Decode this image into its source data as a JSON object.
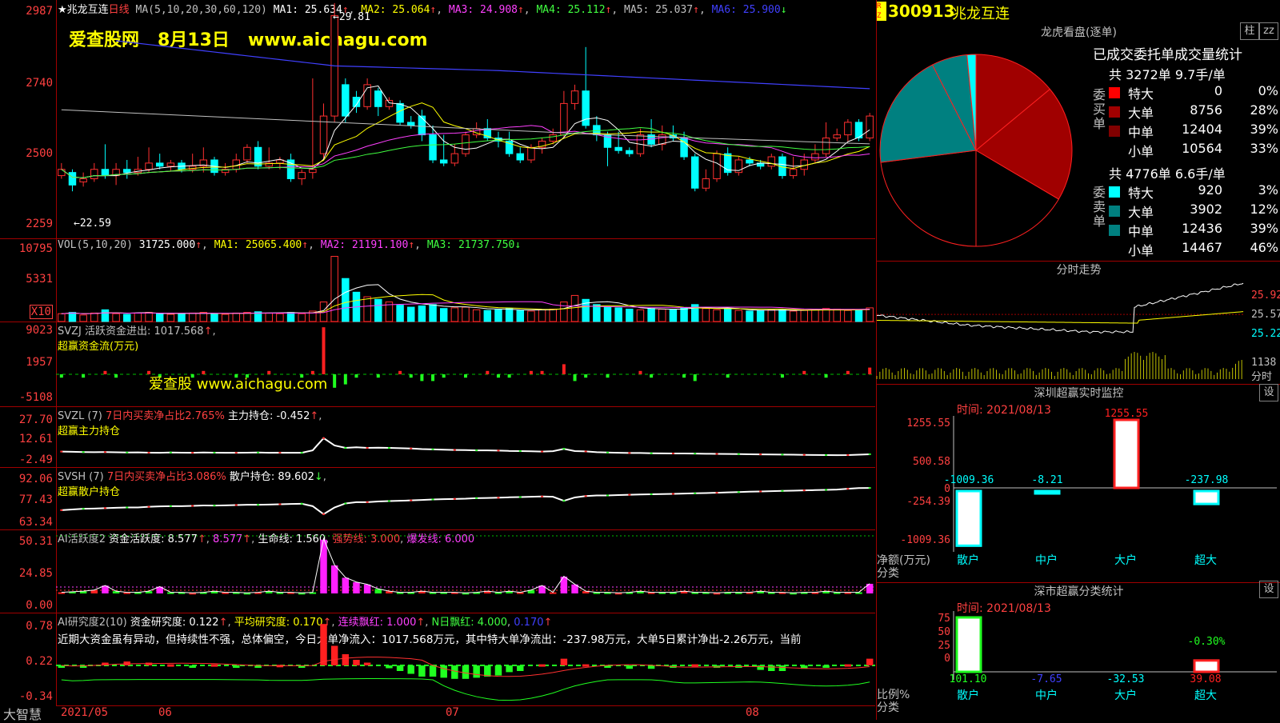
{
  "header": {
    "name": "兆龙互连",
    "period": "日线",
    "ma_params": "MA(5,10,20,30,60,120)",
    "ma1": "MA1: 25.634",
    "ma2": "MA2: 25.064",
    "ma3": "MA3: 24.908",
    "ma4": "MA4: 25.112",
    "ma5": "MA5: 25.037",
    "ma6": "MA6: 25.900",
    "watermark": "爱查股网   8月13日   www.aichagu.com",
    "high_label": "29.81",
    "low_label": "22.59"
  },
  "axes": {
    "main": [
      "2987",
      "2740",
      "2500",
      "2259"
    ],
    "vol": [
      "10795",
      "5331",
      "X10"
    ],
    "svzj": [
      "9023",
      "1957",
      "-5108"
    ],
    "svzl": [
      "27.70",
      "12.61",
      "-2.49"
    ],
    "svsh": [
      "92.06",
      "77.43",
      "63.34"
    ],
    "ai": [
      "50.31",
      "24.85",
      "0.00"
    ],
    "air": [
      "0.78",
      "0.22",
      "-0.34"
    ],
    "dates": [
      "2021/05",
      "06",
      "07",
      "08"
    ],
    "brand": "大智慧"
  },
  "vol_hdr": {
    "a": "VOL(5,10,20)",
    "b": "31725.000",
    "c": "MA1: 25065.400",
    "d": "MA2: 21191.100",
    "e": "MA3: 21737.750"
  },
  "svzj_hdr": {
    "a": "SVZJ  活跃资金进出: 1017.568",
    "b": "超赢资金流(万元)",
    "wm": "爱查股 www.aichagu.com"
  },
  "svzl_hdr": {
    "a": "SVZL (7)",
    "b": "7日内买卖净占比2.765%",
    "c": "主力持仓: -0.452",
    "d": "超赢主力持仓"
  },
  "svsh_hdr": {
    "a": "SVSH (7)",
    "b": "7日内买卖净占比3.086%",
    "c": "散户持仓: 89.602",
    "d": "超赢散户持仓"
  },
  "ai_hdr": {
    "a": "AI活跃度2",
    "b": "资金活跃度: 8.577",
    "c": "8.577",
    "d": "生命线: 1.560",
    "e": "强势线: 3.000",
    "f": "爆发线: 6.000"
  },
  "air_hdr": {
    "a": "AI研究度2(10)",
    "b": "资金研究度: 0.122",
    "c": "平均研究度: 0.170",
    "d": "连续飘红: 1.000",
    "e": "N日飘红: 4.000",
    "f": "0.170",
    "text": "近期大资金虽有异动，但持续性不强，总体偏空，今日大单净流入：1017.568万元，其中特大单净流出：-237.98万元，大单5日累计净出-2.26万元，当前"
  },
  "right": {
    "code": "300913",
    "name": "兆龙互连",
    "rz": "R Z",
    "lhkp": "龙虎看盘(逐单)",
    "btn_zhu": "柱",
    "btn_ji": "zz",
    "stats_title": "已成交委托单成交量统计",
    "buy_total": "共 3272单 9.7手/单",
    "buy_label": "委买单",
    "sell_total": "共 4776单 6.6手/单",
    "sell_label": "委卖单",
    "buy": [
      {
        "n": "特大",
        "v": "0",
        "p": "0%",
        "c": "#ff0000"
      },
      {
        "n": "大单",
        "v": "8756",
        "p": "28%",
        "c": "#a00000"
      },
      {
        "n": "中单",
        "v": "12404",
        "p": "39%",
        "c": "#800000"
      },
      {
        "n": "小单",
        "v": "10564",
        "p": "33%",
        "c": "#000000"
      }
    ],
    "sell": [
      {
        "n": "特大",
        "v": "920",
        "p": "3%",
        "c": "#00ffff"
      },
      {
        "n": "大单",
        "v": "3902",
        "p": "12%",
        "c": "#008080"
      },
      {
        "n": "中单",
        "v": "12436",
        "p": "39%",
        "c": "#008080"
      },
      {
        "n": "小单",
        "v": "14467",
        "p": "46%",
        "c": "#000000"
      }
    ],
    "fs_title": "分时走势",
    "fs_y": [
      "25.92",
      "25.57",
      "25.22"
    ],
    "fs_vol": "1138",
    "fs_unit": "分时",
    "mon_title": "深圳超赢实时监控",
    "mon_set": "设",
    "mon_time": "时间: 2021/08/13",
    "mon_y": [
      "1255.55",
      "500.58",
      "0",
      "-254.39",
      "-1009.36"
    ],
    "mon_unit": "净额(万元)",
    "mon_cls": "分类",
    "mon_vals": [
      "-1009.36",
      "-8.21",
      "1255.55",
      "-237.98"
    ],
    "cats": [
      "散户",
      "中户",
      "大户",
      "超大"
    ],
    "cls_title": "深市超赢分类统计",
    "cls_set": "设",
    "cls_time": "时间: 2021/08/13",
    "cls_y": [
      "75",
      "50",
      "25",
      "0"
    ],
    "cls_unit": "比例%",
    "cls_cls": "分类",
    "cls_vals": [
      "101.10",
      "-7.65",
      "-32.53",
      "39.08"
    ],
    "cls_top": "-0.30%"
  },
  "chart_data": {
    "type": "candlestick",
    "main_ylim": [
      2230,
      2990
    ],
    "candles": [
      [
        2430,
        2450,
        2420,
        2470
      ],
      [
        2440,
        2400,
        2380,
        2450
      ],
      [
        2410,
        2420,
        2395,
        2440
      ],
      [
        2420,
        2450,
        2410,
        2470
      ],
      [
        2450,
        2430,
        2420,
        2530
      ],
      [
        2430,
        2450,
        2400,
        2470
      ],
      [
        2450,
        2440,
        2420,
        2480
      ],
      [
        2440,
        2450,
        2430,
        2490
      ],
      [
        2450,
        2470,
        2440,
        2520
      ],
      [
        2470,
        2460,
        2450,
        2500
      ],
      [
        2460,
        2470,
        2445,
        2480
      ],
      [
        2470,
        2450,
        2440,
        2480
      ],
      [
        2450,
        2460,
        2440,
        2500
      ],
      [
        2460,
        2480,
        2440,
        2520
      ],
      [
        2480,
        2440,
        2430,
        2490
      ],
      [
        2440,
        2450,
        2430,
        2470
      ],
      [
        2450,
        2480,
        2440,
        2500
      ],
      [
        2480,
        2520,
        2470,
        2530
      ],
      [
        2520,
        2460,
        2450,
        2540
      ],
      [
        2460,
        2470,
        2450,
        2520
      ],
      [
        2470,
        2480,
        2450,
        2490
      ],
      [
        2480,
        2420,
        2410,
        2500
      ],
      [
        2420,
        2440,
        2400,
        2450
      ],
      [
        2440,
        2450,
        2420,
        2740
      ],
      [
        2500,
        2620,
        2480,
        2660
      ],
      [
        2620,
        2940,
        2600,
        2980
      ],
      [
        2720,
        2620,
        2600,
        2740
      ],
      [
        2680,
        2650,
        2630,
        2700
      ],
      [
        2650,
        2720,
        2640,
        2740
      ],
      [
        2700,
        2650,
        2620,
        2710
      ],
      [
        2650,
        2670,
        2640,
        2680
      ],
      [
        2660,
        2600,
        2590,
        2670
      ],
      [
        2600,
        2590,
        2580,
        2620
      ],
      [
        2620,
        2560,
        2540,
        2640
      ],
      [
        2560,
        2480,
        2470,
        2590
      ],
      [
        2480,
        2470,
        2460,
        2560
      ],
      [
        2470,
        2500,
        2460,
        2530
      ],
      [
        2500,
        2560,
        2490,
        2570
      ],
      [
        2560,
        2580,
        2550,
        2600
      ],
      [
        2580,
        2550,
        2540,
        2610
      ],
      [
        2550,
        2540,
        2520,
        2570
      ],
      [
        2540,
        2500,
        2490,
        2570
      ],
      [
        2500,
        2480,
        2470,
        2520
      ],
      [
        2480,
        2520,
        2470,
        2530
      ],
      [
        2520,
        2540,
        2500,
        2550
      ],
      [
        2540,
        2560,
        2530,
        2580
      ],
      [
        2560,
        2660,
        2550,
        2700
      ],
      [
        2660,
        2700,
        2640,
        2720
      ],
      [
        2700,
        2590,
        2580,
        2840
      ],
      [
        2590,
        2560,
        2540,
        2620
      ],
      [
        2560,
        2520,
        2460,
        2570
      ],
      [
        2520,
        2510,
        2500,
        2570
      ],
      [
        2510,
        2500,
        2490,
        2520
      ],
      [
        2500,
        2560,
        2490,
        2580
      ],
      [
        2560,
        2530,
        2520,
        2610
      ],
      [
        2530,
        2560,
        2510,
        2590
      ],
      [
        2560,
        2550,
        2540,
        2590
      ],
      [
        2550,
        2490,
        2480,
        2570
      ],
      [
        2490,
        2390,
        2380,
        2500
      ],
      [
        2390,
        2420,
        2380,
        2450
      ],
      [
        2420,
        2500,
        2410,
        2510
      ],
      [
        2500,
        2440,
        2430,
        2520
      ],
      [
        2440,
        2480,
        2430,
        2490
      ],
      [
        2480,
        2470,
        2460,
        2490
      ],
      [
        2470,
        2460,
        2450,
        2480
      ],
      [
        2460,
        2490,
        2450,
        2500
      ],
      [
        2490,
        2430,
        2420,
        2500
      ],
      [
        2430,
        2450,
        2420,
        2490
      ],
      [
        2450,
        2480,
        2430,
        2500
      ],
      [
        2480,
        2500,
        2470,
        2530
      ],
      [
        2500,
        2550,
        2490,
        2600
      ],
      [
        2550,
        2560,
        2540,
        2580
      ],
      [
        2560,
        2600,
        2540,
        2610
      ],
      [
        2600,
        2550,
        2540,
        2610
      ],
      [
        2550,
        2620,
        2540,
        2630
      ]
    ],
    "vol": [
      12,
      14,
      10,
      13,
      18,
      12,
      11,
      13,
      14,
      12,
      11,
      12,
      13,
      14,
      12,
      11,
      13,
      14,
      15,
      13,
      12,
      14,
      12,
      16,
      30,
      100,
      66,
      45,
      38,
      34,
      30,
      25,
      22,
      24,
      26,
      20,
      21,
      22,
      18,
      17,
      18,
      20,
      17,
      16,
      18,
      19,
      30,
      40,
      34,
      26,
      22,
      21,
      19,
      18,
      20,
      19,
      18,
      21,
      26,
      20,
      18,
      19,
      17,
      16,
      17,
      18,
      19,
      16,
      17,
      18,
      20,
      19,
      17,
      18,
      21
    ],
    "svzj": [
      -1,
      0,
      -1,
      0,
      1,
      -1,
      0,
      0,
      1,
      -1,
      0,
      0,
      -1,
      1,
      0,
      0,
      -1,
      -1,
      0,
      1,
      0,
      0,
      -1,
      1,
      14,
      -4,
      -3,
      -1,
      0,
      -1,
      0,
      1,
      -1,
      -2,
      -2,
      -1,
      0,
      -1,
      0,
      1,
      -1,
      -1,
      0,
      1,
      1,
      0,
      3,
      -2,
      -1,
      0,
      -1,
      0,
      0,
      1,
      -1,
      0,
      0,
      -1,
      -2,
      0,
      0,
      -1,
      0,
      0,
      0,
      0,
      -1,
      0,
      1,
      0,
      -1,
      0,
      1,
      0,
      2
    ],
    "svzl": [
      5,
      4.8,
      4.6,
      4.5,
      4.6,
      4.4,
      4.2,
      4.3,
      4.1,
      4,
      4.2,
      4.1,
      4,
      4.2,
      4.1,
      4,
      4,
      4.1,
      4.2,
      4,
      4.1,
      4,
      4,
      6,
      16,
      10,
      8,
      8.5,
      8,
      8.2,
      8,
      7.8,
      7.5,
      7,
      6.8,
      6.5,
      6.3,
      6.2,
      6,
      6,
      5.8,
      5.5,
      5.4,
      5.2,
      5,
      5.3,
      7.2,
      5.4,
      5.1,
      4.5,
      4.2,
      4,
      3.8,
      3.8,
      3.6,
      3.5,
      3.4,
      3.4,
      3.3,
      3.2,
      3.1,
      3,
      2.9,
      2.8,
      2.7,
      2.6,
      2.5,
      2.4,
      2.3,
      2.2,
      2.1,
      2,
      2.1,
      2.4,
      2.8
    ],
    "svsh": [
      73,
      73.5,
      74,
      74.2,
      74.5,
      74.8,
      75,
      75,
      75.5,
      75.8,
      76,
      76,
      76.2,
      76.5,
      76.4,
      76.6,
      76.8,
      77,
      77,
      77.2,
      77.4,
      77.6,
      77.8,
      76,
      70,
      75,
      78,
      79,
      79,
      79.5,
      79.8,
      80,
      80.3,
      80.6,
      81,
      81.2,
      81.4,
      81.6,
      82,
      82.1,
      82.3,
      82.6,
      82.8,
      83,
      83.2,
      83,
      80,
      82.5,
      83.5,
      84,
      84,
      84.3,
      84.5,
      84.7,
      84.9,
      85,
      85.2,
      85.4,
      85.6,
      85.8,
      86,
      86.3,
      86.5,
      86.8,
      87,
      87.2,
      87.4,
      87.6,
      87.8,
      88,
      88.2,
      88.4,
      89,
      89.5,
      89.6
    ],
    "ai": [
      1,
      1.5,
      2,
      3,
      7,
      2,
      1,
      1,
      2,
      6,
      1,
      1,
      0.5,
      1,
      2,
      1,
      1,
      0.5,
      1,
      2,
      1,
      1,
      0.5,
      1,
      48,
      25,
      14,
      10,
      8,
      4,
      2,
      1,
      1,
      2,
      1,
      1,
      1,
      0.5,
      1,
      2,
      1,
      2,
      1,
      3,
      7,
      1,
      15,
      8,
      2,
      1,
      1,
      0.5,
      1,
      2,
      1,
      1,
      1,
      2,
      1,
      1,
      0.5,
      1,
      1,
      1,
      2,
      1,
      1,
      0.5,
      1,
      1,
      2,
      1,
      1,
      1,
      8.6
    ],
    "air": [
      0,
      -0.02,
      0,
      0.02,
      0.05,
      0.08,
      0.07,
      0.06,
      0.05,
      0.04,
      0.02,
      0,
      -0.02,
      0,
      0.02,
      0,
      -0.02,
      -0.03,
      -0.02,
      0,
      0.01,
      0,
      -0.02,
      0.05,
      0.74,
      0.35,
      0.2,
      0.1,
      0.05,
      0,
      -0.05,
      -0.1,
      -0.15,
      -0.2,
      -0.2,
      -0.22,
      -0.24,
      -0.24,
      -0.22,
      -0.2,
      -0.18,
      -0.12,
      -0.1,
      -0.05,
      0.02,
      0.06,
      0.12,
      0.08,
      0.02,
      0,
      -0.02,
      -0.04,
      -0.06,
      -0.08,
      -0.06,
      -0.04,
      -0.02,
      0,
      0.02,
      0.02,
      0,
      -0.02,
      -0.04,
      -0.06,
      -0.08,
      -0.1,
      -0.1,
      -0.08,
      -0.06,
      -0.04,
      -0.02,
      0,
      0.02,
      0.05,
      0.12
    ],
    "pie": {
      "buy": [
        0,
        28,
        39,
        33
      ],
      "sell": [
        3,
        12,
        39,
        46
      ]
    },
    "monitor": [
      -1009.36,
      -8.21,
      1255.55,
      -237.98
    ],
    "classify": [
      101.1,
      -7.65,
      -32.53,
      39.08
    ]
  }
}
